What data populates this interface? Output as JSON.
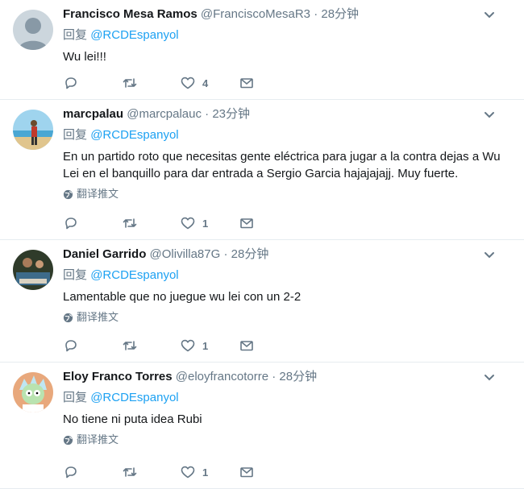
{
  "ui": {
    "reply_prefix": "回复",
    "translate_label": "翻译推文",
    "dot": "·"
  },
  "tweets": [
    {
      "name": "Francisco Mesa Ramos",
      "handle": "@FranciscoMesaR3",
      "time": "28分钟",
      "reply_to": "@RCDEspanyol",
      "text": "Wu lei!!!",
      "has_translate": false,
      "like_count": "4"
    },
    {
      "name": "marcpalau",
      "handle": "@marcpalauc",
      "time": "23分钟",
      "reply_to": "@RCDEspanyol",
      "text": "En un partido roto que necesitas gente eléctrica para jugar a la contra dejas a Wu Lei en el banquillo para dar entrada a Sergio Garcia hajajajajj. Muy fuerte.",
      "has_translate": true,
      "like_count": "1"
    },
    {
      "name": "Daniel Garrido",
      "handle": "@Olivilla87G",
      "time": "28分钟",
      "reply_to": "@RCDEspanyol",
      "text": "Lamentable que no juegue wu lei con un 2-2",
      "has_translate": true,
      "like_count": "1"
    },
    {
      "name": "Eloy Franco Torres",
      "handle": "@eloyfrancotorre",
      "time": "28分钟",
      "reply_to": "@RCDEspanyol",
      "text": "No tiene ni puta idea Rubi",
      "has_translate": true,
      "like_count": "1"
    }
  ],
  "colors": {
    "accent": "#1da1f2",
    "muted": "#657786",
    "text": "#14171a",
    "divider": "#e6ecf0"
  },
  "icons": [
    "reply-icon",
    "retweet-icon",
    "heart-icon",
    "dm-icon",
    "chevron-down-icon",
    "globe-icon"
  ]
}
